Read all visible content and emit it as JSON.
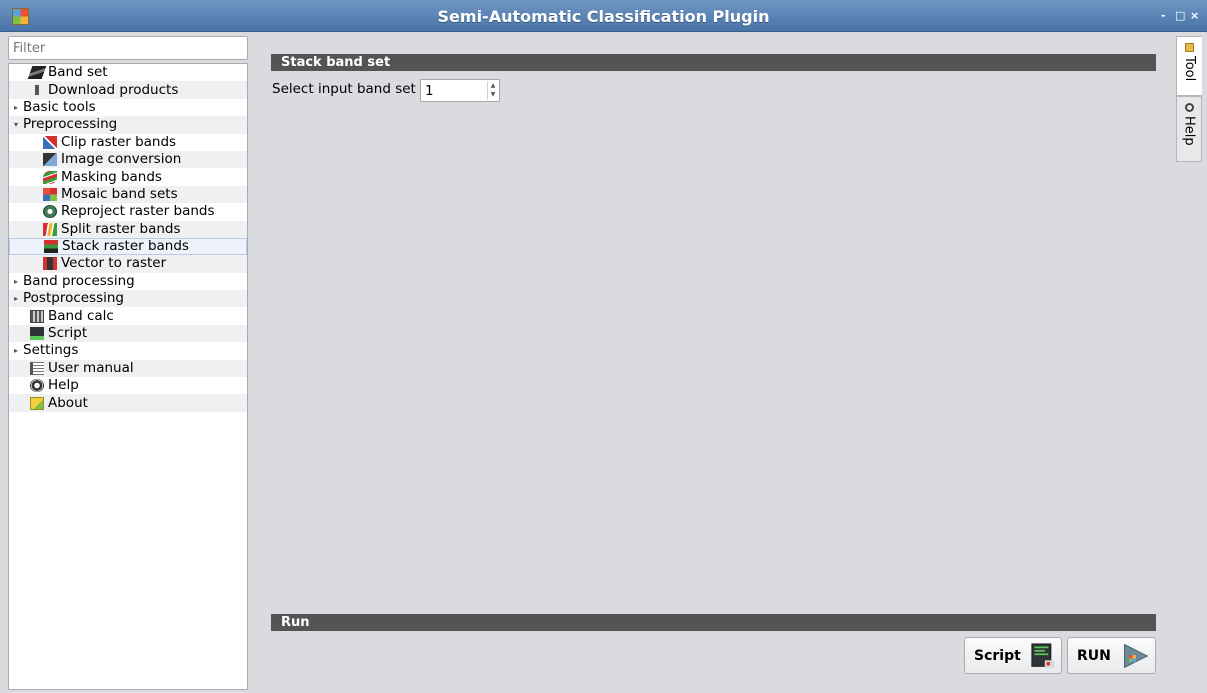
{
  "window": {
    "title": "Semi-Automatic Classification Plugin",
    "controls": [
      "-",
      "□",
      "×"
    ]
  },
  "filter": {
    "placeholder": "Filter"
  },
  "tree": [
    {
      "label": "Band set",
      "level": 0,
      "icon": "band-set-icon",
      "expander": ""
    },
    {
      "label": "Download products",
      "level": 0,
      "icon": "download-icon",
      "expander": ""
    },
    {
      "label": "Basic tools",
      "level": 0,
      "icon": "",
      "expander": "▸"
    },
    {
      "label": "Preprocessing",
      "level": 0,
      "icon": "",
      "expander": "▾"
    },
    {
      "label": "Clip raster bands",
      "level": 1,
      "icon": "clip-icon",
      "expander": ""
    },
    {
      "label": "Image conversion",
      "level": 1,
      "icon": "image-conversion-icon",
      "expander": ""
    },
    {
      "label": "Masking bands",
      "level": 1,
      "icon": "masking-icon",
      "expander": ""
    },
    {
      "label": "Mosaic band sets",
      "level": 1,
      "icon": "mosaic-icon",
      "expander": ""
    },
    {
      "label": "Reproject raster bands",
      "level": 1,
      "icon": "reproject-icon",
      "expander": ""
    },
    {
      "label": "Split raster bands",
      "level": 1,
      "icon": "split-icon",
      "expander": ""
    },
    {
      "label": "Stack raster bands",
      "level": 1,
      "icon": "stack-icon",
      "expander": "",
      "selected": true
    },
    {
      "label": "Vector to raster",
      "level": 1,
      "icon": "vector-to-raster-icon",
      "expander": ""
    },
    {
      "label": "Band processing",
      "level": 0,
      "icon": "",
      "expander": "▸"
    },
    {
      "label": "Postprocessing",
      "level": 0,
      "icon": "",
      "expander": "▸"
    },
    {
      "label": "Band calc",
      "level": 0,
      "icon": "calculator-icon",
      "expander": ""
    },
    {
      "label": "Script",
      "level": 0,
      "icon": "script-icon",
      "expander": ""
    },
    {
      "label": "Settings",
      "level": 0,
      "icon": "",
      "expander": "▸"
    },
    {
      "label": "User manual",
      "level": 0,
      "icon": "manual-icon",
      "expander": ""
    },
    {
      "label": "Help",
      "level": 0,
      "icon": "help-icon",
      "expander": ""
    },
    {
      "label": "About",
      "level": 0,
      "icon": "about-icon",
      "expander": ""
    }
  ],
  "side_tabs": {
    "tool": "Tool",
    "help": "Help"
  },
  "main": {
    "section_title": "Stack band set",
    "band_set_label": "Select input band set",
    "band_set_value": "1",
    "run_section": "Run",
    "script_button": "Script",
    "run_button": "RUN"
  }
}
